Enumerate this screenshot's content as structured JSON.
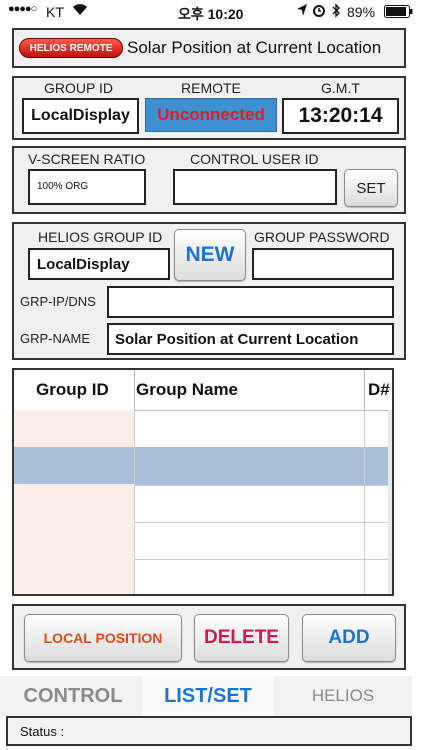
{
  "statusbar": {
    "carrier": "KT",
    "time": "오후 10:20",
    "battery": "89%"
  },
  "header": {
    "badge": "HELIOS REMOTE",
    "title": "Solar Position at Current Location"
  },
  "group_panel": {
    "group_id_label": "GROUP ID",
    "group_id_value": "LocalDisplay",
    "remote_label": "REMOTE",
    "remote_value": "Unconnected",
    "gmt_label": "G.M.T",
    "gmt_value": "13:20:14"
  },
  "screen_panel": {
    "ratio_label": "V-SCREEN RATIO",
    "ratio_value": "100% ORG",
    "control_user_label": "CONTROL USER ID",
    "control_user_value": "",
    "set_label": "SET"
  },
  "helios_panel": {
    "group_id_label": "HELIOS GROUP ID",
    "group_id_value": "LocalDisplay",
    "new_label": "NEW",
    "password_label": "GROUP PASSWORD",
    "password_value": "",
    "ip_label": "GRP-IP/DNS",
    "ip_value": "",
    "name_label": "GRP-NAME",
    "name_value": "Solar Position at Current Location"
  },
  "table": {
    "columns": [
      "Group ID",
      "Group Name",
      "D#"
    ],
    "selected_row": 1
  },
  "actions": {
    "local_position": "LOCAL POSITION",
    "delete": "DELETE",
    "add": "ADD"
  },
  "tabs": {
    "control": "CONTROL",
    "list_set": "LIST/SET",
    "helios": "HELIOS"
  },
  "status": {
    "label": "Status :"
  },
  "colors": {
    "remote_bg": "#3d8fd0",
    "remote_text": "#e02020",
    "accent_blue": "#1a73d9",
    "delete_red": "#d6164a",
    "local_orange": "#e24a1a",
    "selected_row": "#aabfda"
  }
}
